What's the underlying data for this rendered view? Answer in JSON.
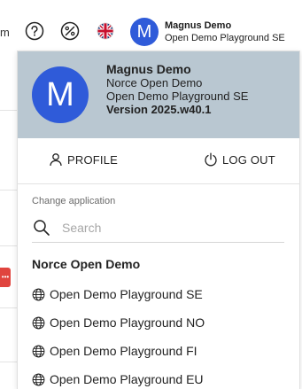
{
  "topbar": {
    "cut_text": "m",
    "icons": [
      "help-icon",
      "percent-icon",
      "uk-flag-icon"
    ],
    "avatar_letter": "M",
    "user_name": "Magnus Demo",
    "user_company": "Open Demo Playground SE"
  },
  "background": {
    "chip_text": "•••"
  },
  "panel": {
    "header": {
      "avatar_letter": "M",
      "name": "Magnus Demo",
      "organization": "Norce Open Demo",
      "application": "Open Demo Playground SE",
      "version": "Version 2025.w40.1"
    },
    "actions": {
      "profile_label": "PROFILE",
      "logout_label": "LOG OUT"
    },
    "change_application_label": "Change application",
    "search": {
      "placeholder": "Search",
      "value": ""
    },
    "group_title": "Norce Open Demo",
    "applications": [
      {
        "label": "Open Demo Playground SE"
      },
      {
        "label": "Open Demo Playground NO"
      },
      {
        "label": "Open Demo Playground FI"
      },
      {
        "label": "Open Demo Playground EU"
      }
    ]
  },
  "colors": {
    "accent_blue": "#2f5bd9",
    "header_bg": "#b9c7d1",
    "flag_red": "#c8102e",
    "flag_blue": "#012169"
  }
}
